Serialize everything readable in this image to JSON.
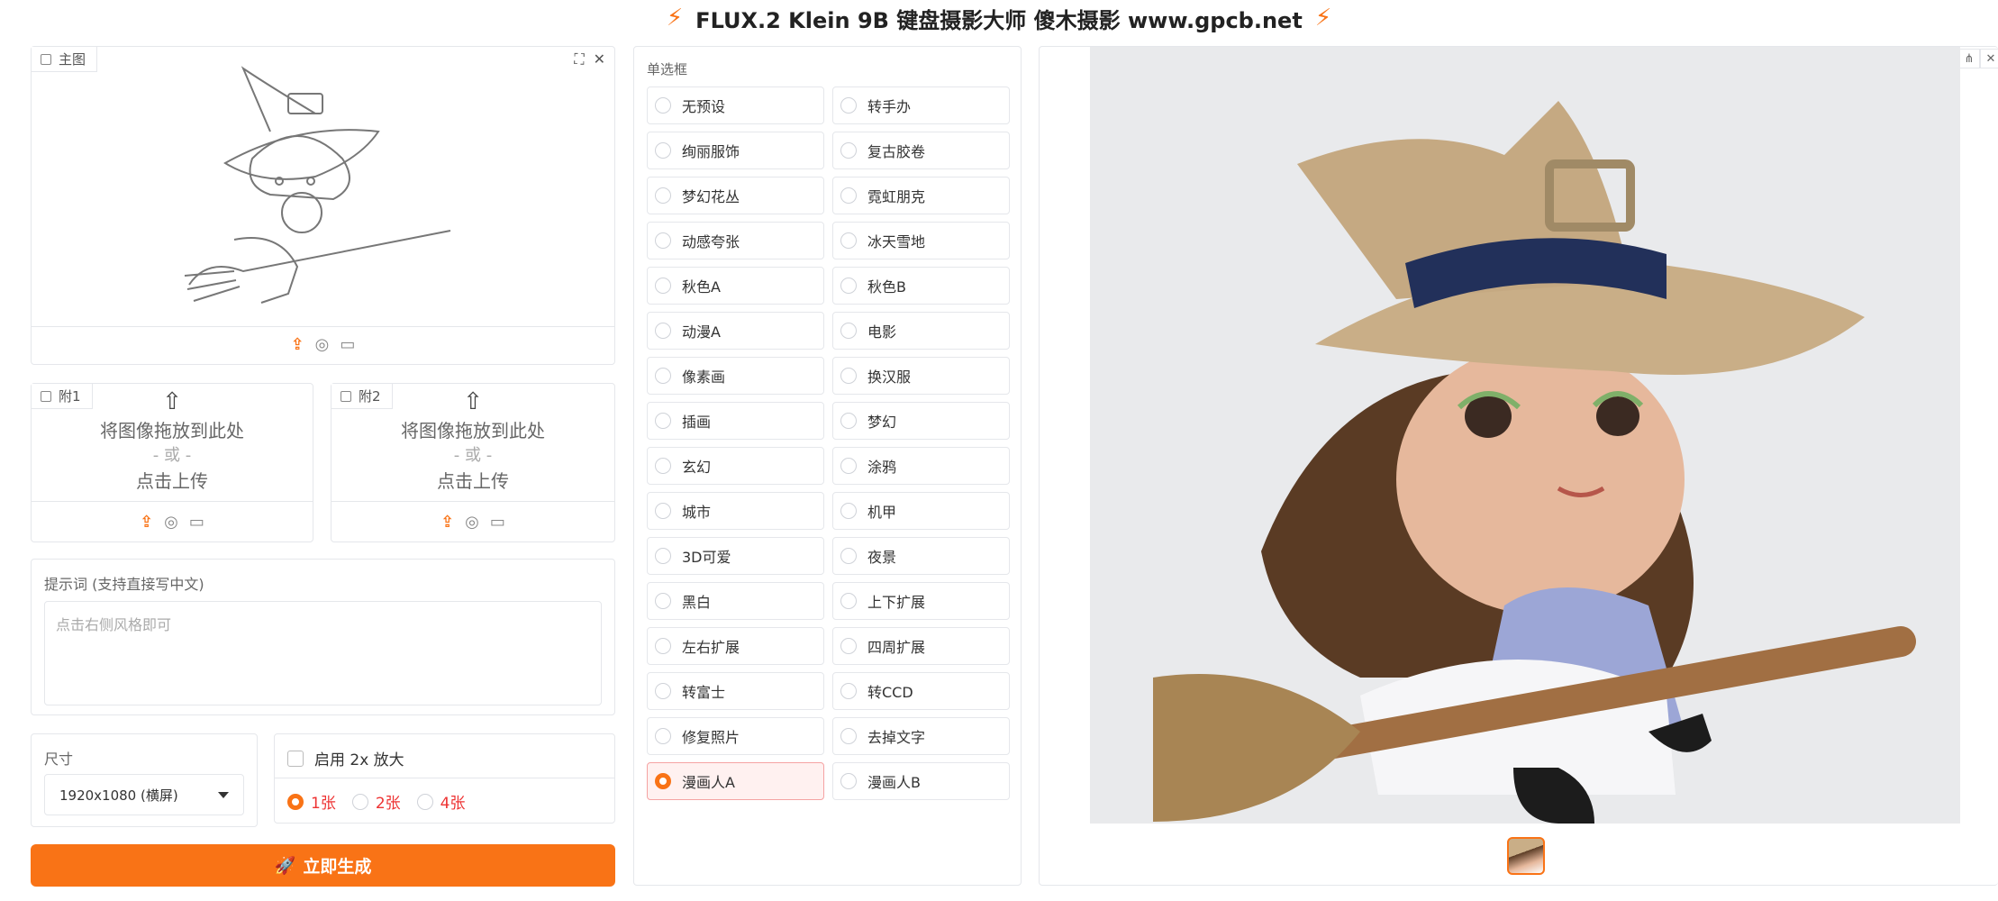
{
  "header": {
    "title": "FLUX.2 Klein 9B 键盘摄影大师 傻木摄影 www.gpcb.net"
  },
  "main_image": {
    "tag": "主图"
  },
  "attach1": {
    "tag": "附1",
    "drop_text": "将图像拖放到此处",
    "or_text": "- 或 -",
    "click_text": "点击上传"
  },
  "attach2": {
    "tag": "附2",
    "drop_text": "将图像拖放到此处",
    "or_text": "- 或 -",
    "click_text": "点击上传"
  },
  "prompt": {
    "label": "提示词 (支持直接写中文)",
    "placeholder": "点击右侧风格即可"
  },
  "size": {
    "label": "尺寸",
    "value": "1920x1080 (横屏)"
  },
  "upscale": {
    "label": "启用 2x 放大",
    "counts": [
      "1张",
      "2张",
      "4张"
    ],
    "selected_count": "1张"
  },
  "generate": {
    "label": "立即生成",
    "icon": "rocket-icon"
  },
  "styles": {
    "label": "单选框",
    "selected": "漫画人A",
    "options": [
      "无预设",
      "转手办",
      "绚丽服饰",
      "复古胶卷",
      "梦幻花丛",
      "霓虹朋克",
      "动感夸张",
      "冰天雪地",
      "秋色A",
      "秋色B",
      "动漫A",
      "电影",
      "像素画",
      "换汉服",
      "插画",
      "梦幻",
      "玄幻",
      "涂鸦",
      "城市",
      "机甲",
      "3D可爱",
      "夜景",
      "黑白",
      "上下扩展",
      "左右扩展",
      "四周扩展",
      "转富士",
      "转CCD",
      "修复照片",
      "去掉文字",
      "漫画人A",
      "漫画人B"
    ]
  },
  "colors": {
    "accent": "#f97316",
    "selected_bg": "#fff1f0"
  }
}
